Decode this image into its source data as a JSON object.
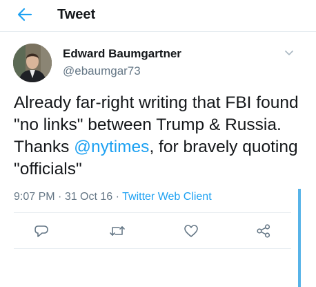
{
  "header": {
    "title": "Tweet"
  },
  "author": {
    "name": "Edward Baumgartner",
    "handle": "@ebaumgar73"
  },
  "tweet": {
    "text_before": "Already far-right writing that FBI found \"no links\" between Trump & Russia. Thanks ",
    "mention": "@nytimes",
    "text_after": ", for bravely quoting \"officials\""
  },
  "meta": {
    "time": "9:07 PM",
    "separator1": " · ",
    "date": "31 Oct 16",
    "separator2": " · ",
    "client": "Twitter Web Client"
  },
  "colors": {
    "accent": "#1da1f2",
    "secondary_text": "#657786",
    "divider": "#e6ecf0"
  },
  "icons": {
    "back": "back-arrow-icon",
    "caret": "chevron-down-icon",
    "reply": "reply-icon",
    "retweet": "retweet-icon",
    "like": "heart-icon",
    "share": "share-icon"
  }
}
